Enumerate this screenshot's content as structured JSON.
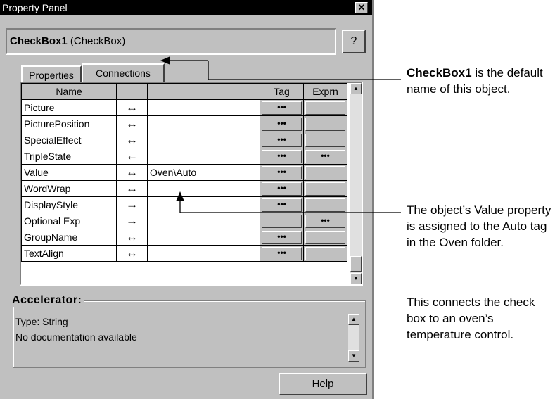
{
  "window": {
    "title": "Property Panel",
    "close_glyph": "✕"
  },
  "object": {
    "name": "CheckBox1",
    "type": "(CheckBox)"
  },
  "help_question": "?",
  "tabs": [
    {
      "label_ul": "P",
      "label_rest": "roperties"
    },
    {
      "label": "Connections"
    }
  ],
  "grid": {
    "headers": [
      "Name",
      "",
      "",
      "Tag",
      "Exprn"
    ],
    "rows": [
      {
        "name": "Picture",
        "dir": "↔",
        "value": "",
        "tag": "•••",
        "expr": ""
      },
      {
        "name": "PicturePosition",
        "dir": "↔",
        "value": "",
        "tag": "•••",
        "expr": ""
      },
      {
        "name": "SpecialEffect",
        "dir": "↔",
        "value": "",
        "tag": "•••",
        "expr": ""
      },
      {
        "name": "TripleState",
        "dir": "←",
        "value": "",
        "tag": "•••",
        "expr": "•••"
      },
      {
        "name": "Value",
        "dir": "↔",
        "value": "Oven\\Auto",
        "tag": "•••",
        "expr": ""
      },
      {
        "name": "WordWrap",
        "dir": "↔",
        "value": "",
        "tag": "•••",
        "expr": ""
      },
      {
        "name": "DisplayStyle",
        "dir": "→",
        "value": "",
        "tag": "•••",
        "expr": ""
      },
      {
        "name": " Optional Exp",
        "dir": "→",
        "value": "",
        "tag": "",
        "expr": "•••"
      },
      {
        "name": "GroupName",
        "dir": "↔",
        "value": "",
        "tag": "•••",
        "expr": ""
      },
      {
        "name": "TextAlign",
        "dir": "↔",
        "value": "",
        "tag": "•••",
        "expr": ""
      }
    ]
  },
  "accelerator": {
    "title": "Accelerator:",
    "type_line": "Type: String",
    "doc_line": "No documentation available"
  },
  "help_button": {
    "label_ul": "H",
    "label_rest": "elp"
  },
  "callouts": {
    "c1_bold": "CheckBox1",
    "c1_rest": " is the default name of this object.",
    "c2": "The object’s Value property is assigned to the Auto tag in the Oven folder.",
    "c3": "This connects the check box to an oven’s temperature control."
  }
}
